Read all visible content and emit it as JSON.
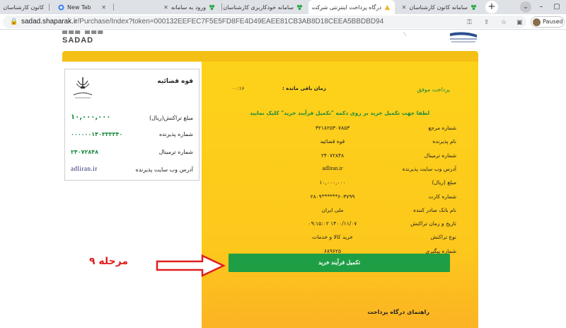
{
  "browser": {
    "tabs": [
      {
        "label": "کانون کارشناسان",
        "active": false
      },
      {
        "label": "New Tab",
        "active": false
      },
      {
        "label": "ورود به سامانه",
        "active": false
      },
      {
        "label": "سامانه خودکاربری کارشناسان",
        "active": false
      },
      {
        "label": "درگاه پرداخت اینترنتی شرکت",
        "active": true
      },
      {
        "label": "سامانه کانون کارشناسان",
        "active": false
      }
    ],
    "url_host": "sadad.shaparak.ir",
    "url_path": "/Purchase/Index?token=000132EEFEC7F5E5FD8FE4D49EAEE81CB3AB8D18CEEA5BBDBD94",
    "profile_label": "Paused"
  },
  "brand": {
    "sadad_name": "SADAD"
  },
  "merchant_card": {
    "title": "قوه قضائیه",
    "amount_label": "مبلغ تراکنش(ریال)",
    "amount_value": "۱۰,۰۰۰,۰۰۰",
    "acceptor_no_label": "شماره پذیرنده",
    "acceptor_no_value": "۰۰۰۰۰۰۱۴۰۳۳۳۳۴۰",
    "terminal_label": "شماره ترمینال",
    "terminal_value": "۲۴۰۷۲۸۴۸",
    "website_label": "آدرس وب سایت پذیرنده",
    "website_value": "adliran.ir"
  },
  "payment": {
    "status": "پرداخت موفق",
    "timer_label": "زمان باقی مانده :",
    "timer_value": "۰۰:۱۶",
    "instruction": "لطفا جهت تکمیل خرید بر روی دکمه \"تکمیل فرآیند خرید\" کلیک نمایید",
    "fields": [
      {
        "label": "شماره مرجع",
        "value": "۳۲۱۸۲۵۳۰۷۸۵۳",
        "latin": false
      },
      {
        "label": "نام پذیرنده",
        "value": "قوه قضائیه",
        "latin": false
      },
      {
        "label": "شماره ترمینال",
        "value": "۲۴۰۷۲۸۴۸",
        "latin": false
      },
      {
        "label": "آدرس وب سایت پذیرنده",
        "value": "adliran.ir",
        "latin": true
      },
      {
        "label": "مبلغ (ریال)",
        "value": "۱۰,۰۰۰,۰۰۰",
        "latin": false
      },
      {
        "label": "شماره کارت",
        "value": "۶۰۳۷۹۹******۲۸۰۹",
        "latin": false
      },
      {
        "label": "نام بانک صادر کننده",
        "value": "ملی ایران",
        "latin": false
      },
      {
        "label": "تاریخ و زمان تراکنش",
        "value": "۱۴۰۰/۱۱/۰۷ ۰۹:۱۵:۰۲",
        "latin": false
      },
      {
        "label": "نوع تراکنش",
        "value": "خرید کالا و خدمات",
        "latin": false
      },
      {
        "label": "شماره پیگیری",
        "value": "۶۸۹۶۲۵",
        "latin": false
      }
    ],
    "complete_button": "تکمیل فرآیند خرید"
  },
  "annotation": {
    "step": "مرحله ۹"
  },
  "footer": {
    "guide_title": "راهنمای درگاه پرداخت"
  },
  "colors": {
    "accent_green": "#1e9e45",
    "panel_yellow": "#fdd21a",
    "annotation_red": "#e02020"
  }
}
